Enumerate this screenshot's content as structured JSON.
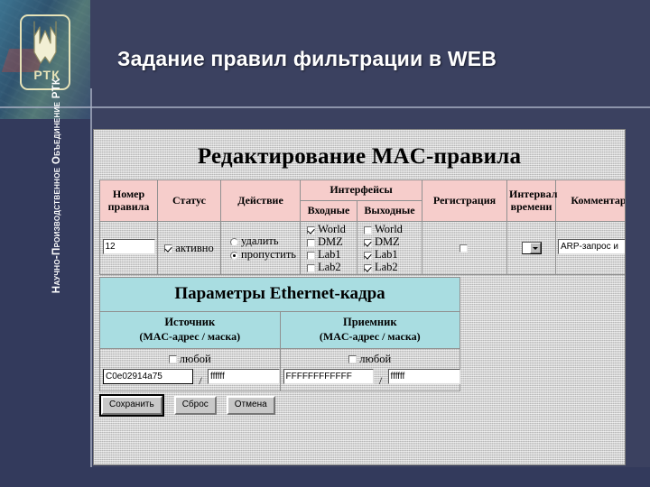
{
  "slide": {
    "title": "Задание правил фильтрации в WEB",
    "side_caption": "Научно-Производственное Объединение РТК",
    "logo_text": "РТК"
  },
  "page": {
    "heading": "Редактирование MAC-правила"
  },
  "rules_table": {
    "headers": {
      "number": "Номер правила",
      "status": "Статус",
      "action": "Действие",
      "interfaces": "Интерфейсы",
      "interfaces_in": "Входные",
      "interfaces_out": "Выходные",
      "registration": "Регистрация",
      "time_interval": "Интервал времени",
      "comment": "Комментар"
    },
    "row": {
      "rule_number_value": "12",
      "status_label": "активно",
      "status_checked": true,
      "action_options": [
        {
          "label": "удалить",
          "selected": false
        },
        {
          "label": "пропустить",
          "selected": true
        }
      ],
      "interfaces_in": [
        {
          "label": "World",
          "checked": true
        },
        {
          "label": "DMZ",
          "checked": false
        },
        {
          "label": "Lab1",
          "checked": false
        },
        {
          "label": "Lab2",
          "checked": false
        }
      ],
      "interfaces_out": [
        {
          "label": "World",
          "checked": false
        },
        {
          "label": "DMZ",
          "checked": true
        },
        {
          "label": "Lab1",
          "checked": true
        },
        {
          "label": "Lab2",
          "checked": true
        }
      ],
      "registration_checked": false,
      "time_interval_selected": "",
      "comment_value": "ARP-запрос и"
    }
  },
  "ethernet": {
    "title": "Параметры Ethernet-кадра",
    "source": {
      "title": "Источник",
      "subtitle": "(MAC-адрес / маска)",
      "any_label": "любой",
      "any_checked": false,
      "mac_value": "C0e02914a75",
      "mask_value": "ffffff"
    },
    "destination": {
      "title": "Приемник",
      "subtitle": "(MAC-адрес / маска)",
      "any_label": "любой",
      "any_checked": false,
      "mac_value": "FFFFFFFFFFFF",
      "mask_value": "ffffff"
    }
  },
  "buttons": {
    "save": "Сохранить",
    "reset": "Сброс",
    "cancel": "Отмена"
  },
  "colors": {
    "slide_background": "#3b4160",
    "header_pink": "#f6cdcb",
    "section_cyan": "#a9dde1",
    "logo_gold": "#e6e2b8",
    "title_text": "#ffffff"
  }
}
